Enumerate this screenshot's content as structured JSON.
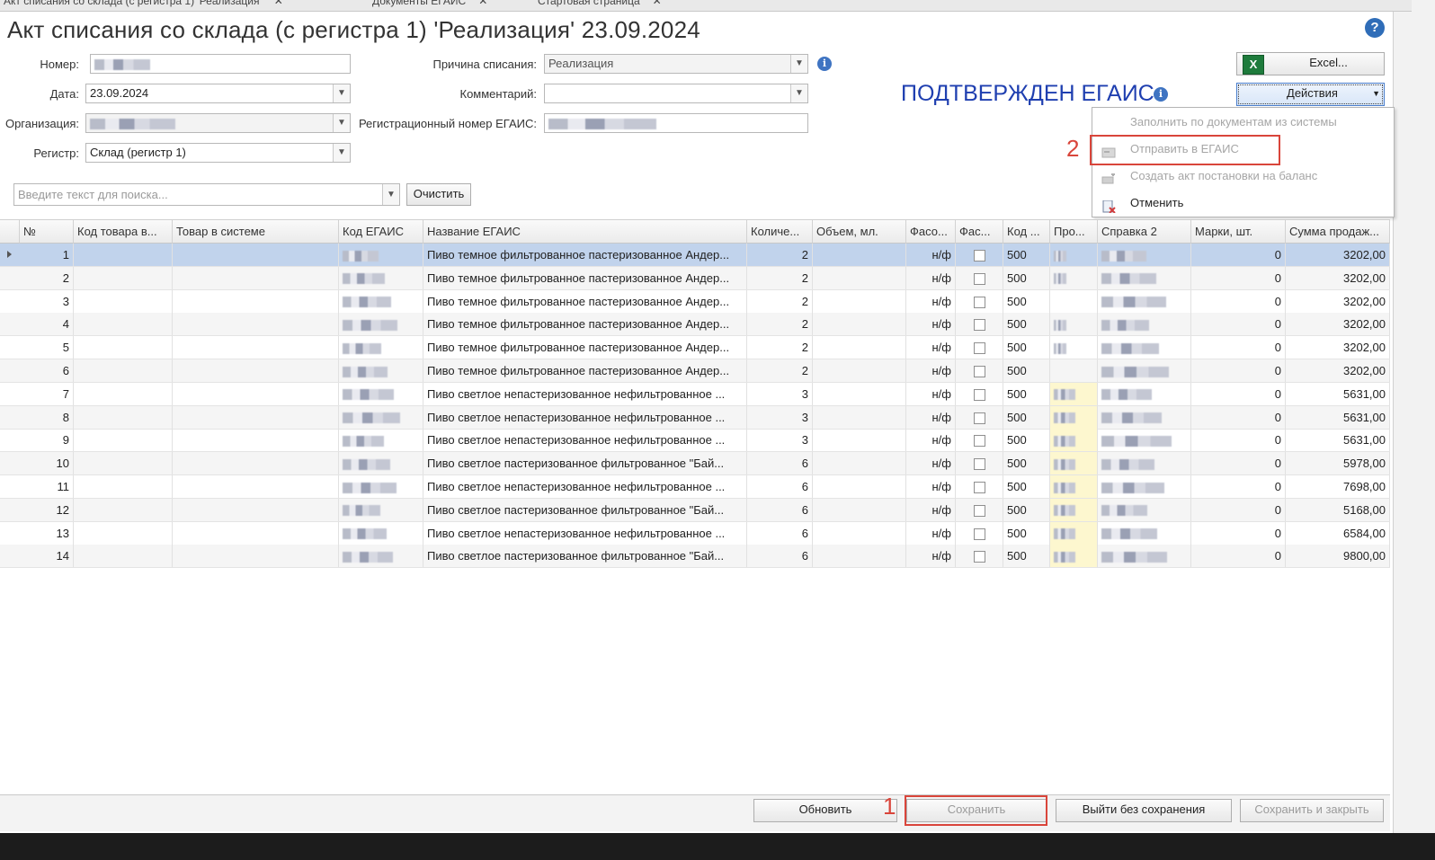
{
  "tabs": [
    {
      "label": "Акт списания со склада (с регистра 1) 'Реализация'"
    },
    {
      "label": "Документы ЕГАИС"
    },
    {
      "label": "Стартовая страница"
    }
  ],
  "document": {
    "title": "Акт списания со склада (с регистра 1) 'Реализация' 23.09.2024"
  },
  "form": {
    "number_label": "Номер:",
    "date_label": "Дата:",
    "date_value": "23.09.2024",
    "org_label": "Организация:",
    "register_label": "Регистр:",
    "register_value": "Склад (регистр 1)",
    "reason_label": "Причина списания:",
    "reason_value": "Реализация",
    "comment_label": "Комментарий:",
    "comment_value": "",
    "egais_reg_label": "Регистрационный номер ЕГАИС:"
  },
  "status": {
    "text": "ПОДТВЕРЖДЕН ЕГАИС",
    "color": "#1f3fb0"
  },
  "buttons": {
    "excel": "Excel...",
    "actions": "Действия",
    "clear": "Очистить",
    "refresh": "Обновить",
    "save": "Сохранить",
    "exit_no_save": "Выйти без сохранения",
    "save_close": "Сохранить и закрыть"
  },
  "search": {
    "placeholder": "Введите текст для поиска..."
  },
  "actions_menu": {
    "items": [
      {
        "label": "Заполнить по документам из системы",
        "enabled": false,
        "icon": "none"
      },
      {
        "label": "Отправить в ЕГАИС",
        "enabled": false,
        "icon": "send-icon"
      },
      {
        "label": "Создать акт постановки на баланс",
        "enabled": false,
        "icon": "create-act-icon"
      },
      {
        "label": "Отменить",
        "enabled": true,
        "icon": "cancel-doc-icon"
      }
    ]
  },
  "annotations": {
    "marker1": "1",
    "marker2": "2",
    "color": "#d9453b"
  },
  "table": {
    "columns": [
      "№",
      "Код товара в...",
      "Товар в системе",
      "Код ЕГАИС",
      "Название ЕГАИС",
      "Количе...",
      "Объем, мл.",
      "Фасо...",
      "Фас...",
      "Код ...",
      "Про...",
      "Справка 2",
      "Марки, шт.",
      "Сумма продаж..."
    ],
    "rows": [
      {
        "n": "1",
        "name": "Пиво темное фильтрованное пастеризованное Андер...",
        "qty": "2",
        "pack": "н/ф",
        "code": "500",
        "marks": "0",
        "sum": "3202,00"
      },
      {
        "n": "2",
        "name": "Пиво темное фильтрованное пастеризованное Андер...",
        "qty": "2",
        "pack": "н/ф",
        "code": "500",
        "marks": "0",
        "sum": "3202,00"
      },
      {
        "n": "3",
        "name": "Пиво темное фильтрованное пастеризованное Андер...",
        "qty": "2",
        "pack": "н/ф",
        "code": "500",
        "marks": "0",
        "sum": "3202,00"
      },
      {
        "n": "4",
        "name": "Пиво темное фильтрованное пастеризованное Андер...",
        "qty": "2",
        "pack": "н/ф",
        "code": "500",
        "marks": "0",
        "sum": "3202,00"
      },
      {
        "n": "5",
        "name": "Пиво темное фильтрованное пастеризованное Андер...",
        "qty": "2",
        "pack": "н/ф",
        "code": "500",
        "marks": "0",
        "sum": "3202,00"
      },
      {
        "n": "6",
        "name": "Пиво темное фильтрованное пастеризованное Андер...",
        "qty": "2",
        "pack": "н/ф",
        "code": "500",
        "marks": "0",
        "sum": "3202,00"
      },
      {
        "n": "7",
        "name": "Пиво светлое непастеризованное нефильтрованное ...",
        "qty": "3",
        "pack": "н/ф",
        "code": "500",
        "marks": "0",
        "sum": "5631,00"
      },
      {
        "n": "8",
        "name": "Пиво светлое непастеризованное нефильтрованное ...",
        "qty": "3",
        "pack": "н/ф",
        "code": "500",
        "marks": "0",
        "sum": "5631,00"
      },
      {
        "n": "9",
        "name": "Пиво светлое непастеризованное нефильтрованное ...",
        "qty": "3",
        "pack": "н/ф",
        "code": "500",
        "marks": "0",
        "sum": "5631,00"
      },
      {
        "n": "10",
        "name": "Пиво светлое пастеризованное фильтрованное \"Бай...",
        "qty": "6",
        "pack": "н/ф",
        "code": "500",
        "marks": "0",
        "sum": "5978,00"
      },
      {
        "n": "11",
        "name": "Пиво светлое непастеризованное нефильтрованное ...",
        "qty": "6",
        "pack": "н/ф",
        "code": "500",
        "marks": "0",
        "sum": "7698,00"
      },
      {
        "n": "12",
        "name": "Пиво светлое пастеризованное фильтрованное \"Бай...",
        "qty": "6",
        "pack": "н/ф",
        "code": "500",
        "marks": "0",
        "sum": "5168,00"
      },
      {
        "n": "13",
        "name": "Пиво светлое непастеризованное нефильтрованное ...",
        "qty": "6",
        "pack": "н/ф",
        "code": "500",
        "marks": "0",
        "sum": "6584,00"
      },
      {
        "n": "14",
        "name": "Пиво светлое пастеризованное фильтрованное \"Бай...",
        "qty": "6",
        "pack": "н/ф",
        "code": "500",
        "marks": "0",
        "sum": "9800,00"
      }
    ]
  }
}
